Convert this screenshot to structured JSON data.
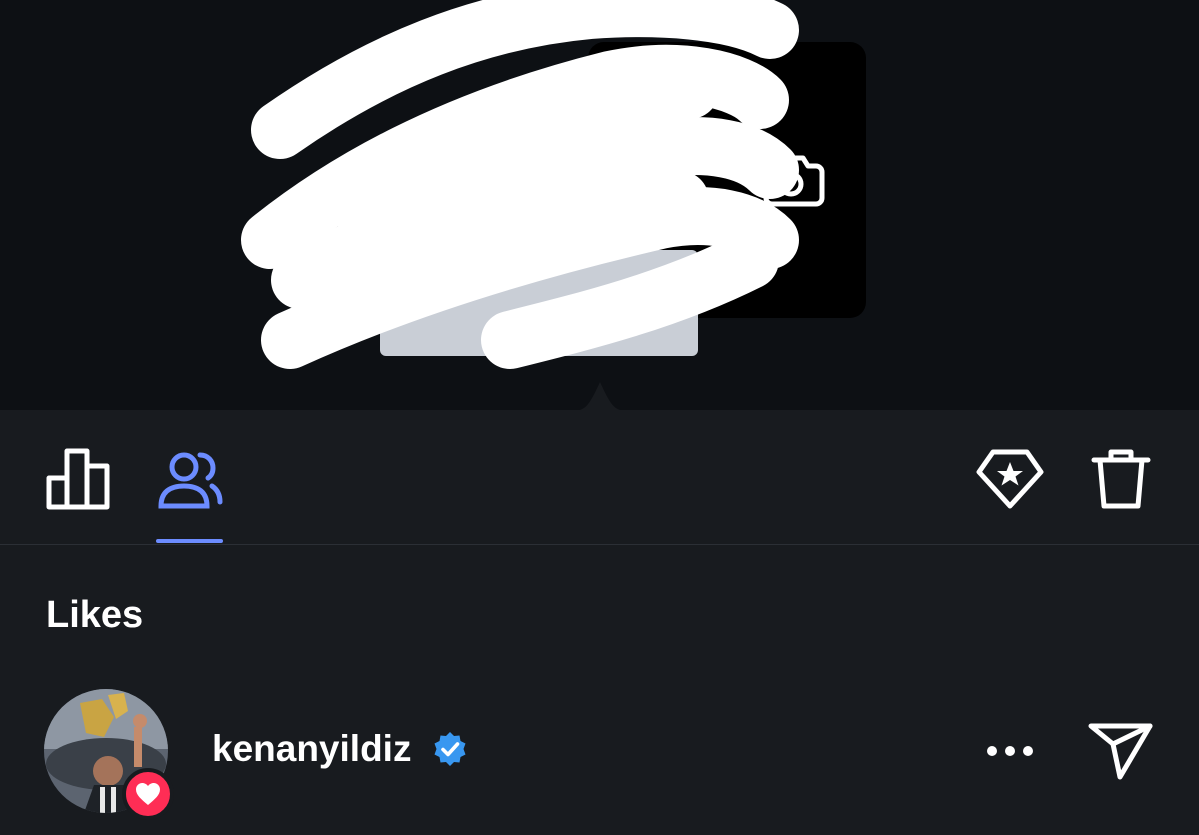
{
  "toolbar": {
    "tabs": [
      {
        "icon": "bar-chart-icon",
        "active": false
      },
      {
        "icon": "people-icon",
        "active": true
      }
    ],
    "actions": [
      {
        "icon": "diamond-star-icon"
      },
      {
        "icon": "trash-icon"
      }
    ]
  },
  "likes": {
    "title": "Likes",
    "items": [
      {
        "username": "kenanyildiz",
        "verified": true,
        "badge_icon": "heart-icon",
        "more_icon": "more-icon",
        "send_icon": "send-icon"
      }
    ]
  },
  "colors": {
    "accent": "#6c8cff",
    "verified": "#3897f0",
    "heart_badge": "#ff2d55",
    "sheet_background": "#181b1f",
    "top_background": "#0d1014"
  }
}
